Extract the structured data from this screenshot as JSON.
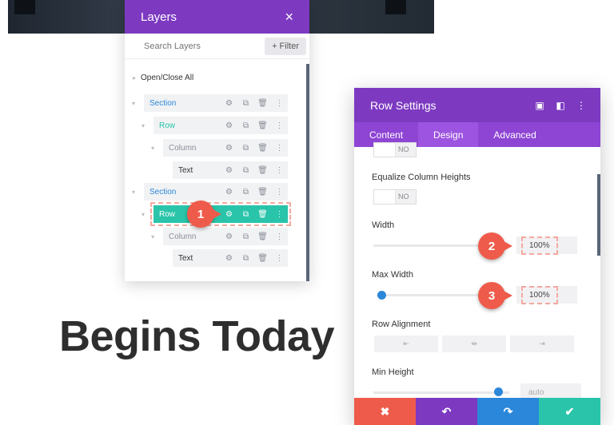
{
  "page": {
    "heading": "Begins Today"
  },
  "layers": {
    "title": "Layers",
    "close_icon": "×",
    "search_placeholder": "Search Layers",
    "filter_label": "+ Filter",
    "open_close_label": "Open/Close All",
    "items": [
      {
        "label": "Section",
        "type": "section"
      },
      {
        "label": "Row",
        "type": "row"
      },
      {
        "label": "Column",
        "type": "column"
      },
      {
        "label": "Text",
        "type": "text"
      },
      {
        "label": "Section",
        "type": "section"
      },
      {
        "label": "Row",
        "type": "row",
        "active": true
      },
      {
        "label": "Column",
        "type": "column"
      },
      {
        "label": "Text",
        "type": "text"
      }
    ]
  },
  "row_settings": {
    "title": "Row Settings",
    "tabs": [
      "Content",
      "Design",
      "Advanced"
    ],
    "active_tab": "Design",
    "top_toggle_text": "NO",
    "equalize_label": "Equalize Column Heights",
    "equalize_toggle_text": "NO",
    "width_label": "Width",
    "width_value": "100%",
    "max_width_label": "Max Width",
    "max_width_value": "100%",
    "row_alignment_label": "Row Alignment",
    "min_height_label": "Min Height",
    "min_height_value": "auto"
  },
  "footer": {
    "cancel_icon": "✖",
    "undo_icon": "↶",
    "redo_icon": "↷",
    "save_icon": "✔",
    "colors": {
      "cancel": "#ef5b4b",
      "undo": "#7d3ac1",
      "redo": "#2b87da",
      "save": "#29c4a9"
    }
  },
  "badges": [
    "1",
    "2",
    "3"
  ],
  "colors": {
    "purple": "#7d3ac1",
    "teal": "#29c4a9",
    "blue": "#2b87da",
    "red": "#ef5b4b"
  }
}
